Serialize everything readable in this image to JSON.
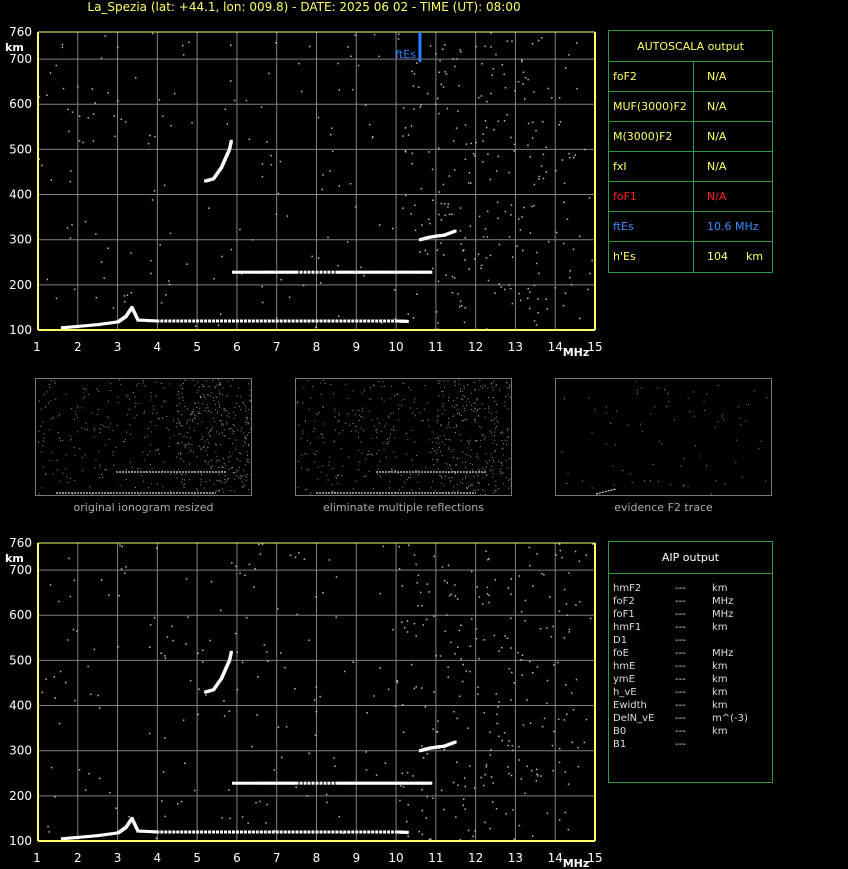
{
  "header": {
    "title": "La_Spezia (lat: +44.1, lon: 009.8) - DATE: 2025 06 02 - TIME (UT): 08:00"
  },
  "colors": {
    "axis": "#ffff66",
    "grid": "#808080",
    "fes_marker": "#2f7dff",
    "panel_border": "#2e9a3a",
    "fof1_label": "#ff2020",
    "fes_label": "#3b8cff",
    "autoscala_title": "#ffff66"
  },
  "ionogram_top": {
    "y_ticks": [
      "760",
      "700",
      "600",
      "500",
      "400",
      "300",
      "200",
      "100"
    ],
    "y_unit": "km",
    "x_ticks": [
      "1",
      "2",
      "3",
      "4",
      "5",
      "6",
      "7",
      "8",
      "9",
      "10",
      "11",
      "12",
      "13",
      "14",
      "15"
    ],
    "x_unit": "MHz",
    "marker_label": "ftEs"
  },
  "ionogram_bottom": {
    "y_ticks": [
      "760",
      "700",
      "600",
      "500",
      "400",
      "300",
      "200",
      "100"
    ],
    "y_unit": "km",
    "x_ticks": [
      "1",
      "2",
      "3",
      "4",
      "5",
      "6",
      "7",
      "8",
      "9",
      "10",
      "11",
      "12",
      "13",
      "14",
      "15"
    ],
    "x_unit": "MHz"
  },
  "chart_data": [
    {
      "type": "scatter",
      "title": "",
      "xlabel": "MHz",
      "ylabel": "km",
      "xlim": [
        1,
        15
      ],
      "ylim": [
        100,
        760
      ],
      "grid": true,
      "series": [
        {
          "x": [
            1.6,
            2.0,
            2.5,
            3.0,
            3.2,
            3.35,
            3.5,
            4.0,
            5.0,
            6.0,
            7.0,
            8.0,
            9.0,
            10.0,
            10.3
          ],
          "y": [
            105,
            108,
            112,
            118,
            130,
            150,
            122,
            120,
            120,
            120,
            120,
            120,
            120,
            120,
            119
          ]
        },
        {
          "x": [
            5.2,
            5.4,
            5.6,
            5.7,
            5.8,
            5.85
          ],
          "y": [
            430,
            435,
            460,
            480,
            500,
            520
          ]
        },
        {
          "x": [
            5.9,
            6.5,
            7.0,
            7.5,
            8.5,
            9.0,
            9.5,
            10.0,
            10.5,
            10.9
          ],
          "y": [
            228,
            228,
            228,
            228,
            228,
            228,
            228,
            228,
            228,
            228
          ]
        },
        {
          "x": [
            10.6,
            10.8,
            11.0,
            11.2,
            11.5
          ],
          "y": [
            300,
            305,
            308,
            310,
            320
          ]
        }
      ],
      "markers": [
        {
          "label": "ftEs",
          "x": 10.6
        }
      ]
    },
    {
      "type": "scatter",
      "title": "",
      "xlabel": "MHz",
      "ylabel": "km",
      "xlim": [
        1,
        15
      ],
      "ylim": [
        100,
        760
      ],
      "grid": true,
      "series": [
        {
          "x": [
            1.6,
            2.0,
            2.5,
            3.0,
            3.2,
            3.35,
            3.5,
            4.0,
            5.0,
            6.0,
            7.0,
            8.0,
            9.0,
            10.0,
            10.3
          ],
          "y": [
            105,
            108,
            112,
            118,
            130,
            150,
            122,
            120,
            120,
            120,
            120,
            120,
            120,
            120,
            119
          ]
        },
        {
          "x": [
            5.2,
            5.4,
            5.6,
            5.7,
            5.8,
            5.85
          ],
          "y": [
            430,
            435,
            460,
            480,
            500,
            520
          ]
        },
        {
          "x": [
            5.9,
            6.5,
            7.0,
            7.5,
            8.5,
            9.0,
            9.5,
            10.0,
            10.5,
            10.9
          ],
          "y": [
            228,
            228,
            228,
            228,
            228,
            228,
            228,
            228,
            228,
            228
          ]
        },
        {
          "x": [
            10.6,
            10.8,
            11.0,
            11.2,
            11.5
          ],
          "y": [
            300,
            305,
            308,
            310,
            320
          ]
        }
      ]
    }
  ],
  "thumbnails": [
    {
      "caption": "original ionogram resized"
    },
    {
      "caption": "eliminate multiple reflections"
    },
    {
      "caption": "evidence F2 trace"
    }
  ],
  "autoscala": {
    "title": "AUTOSCALA output",
    "rows": [
      {
        "label": "foF2",
        "value": "N/A",
        "color": "#ffff66"
      },
      {
        "label": "MUF(3000)F2",
        "value": "N/A",
        "color": "#ffff66"
      },
      {
        "label": "M(3000)F2",
        "value": "N/A",
        "color": "#ffff66"
      },
      {
        "label": "fxI",
        "value": "N/A",
        "color": "#ffff66"
      },
      {
        "label": "foF1",
        "value": "N/A",
        "color": "#ff2020"
      },
      {
        "label": "ftEs",
        "value": "10.6 MHz",
        "color": "#3b8cff"
      },
      {
        "label": "h'Es",
        "value": "104",
        "unit": "km",
        "color": "#ffff66"
      }
    ]
  },
  "aip": {
    "title": "AIP output",
    "rows": [
      {
        "label": "hmF2",
        "value": "---",
        "unit": "km"
      },
      {
        "label": "foF2",
        "value": "---",
        "unit": "MHz"
      },
      {
        "label": "foF1",
        "value": "---",
        "unit": "MHz"
      },
      {
        "label": "hmF1",
        "value": "---",
        "unit": "km"
      },
      {
        "label": "D1",
        "value": "---",
        "unit": ""
      },
      {
        "label": "foE",
        "value": "---",
        "unit": "MHz"
      },
      {
        "label": "hmE",
        "value": "---",
        "unit": "km"
      },
      {
        "label": "ymE",
        "value": "---",
        "unit": "km"
      },
      {
        "label": "h_vE",
        "value": "---",
        "unit": "km"
      },
      {
        "label": "Ewidth",
        "value": "---",
        "unit": "km"
      },
      {
        "label": "DelN_vE",
        "value": "---",
        "unit": "m^(-3)"
      },
      {
        "label": "B0",
        "value": "---",
        "unit": "km"
      },
      {
        "label": "B1",
        "value": "---",
        "unit": ""
      }
    ]
  }
}
